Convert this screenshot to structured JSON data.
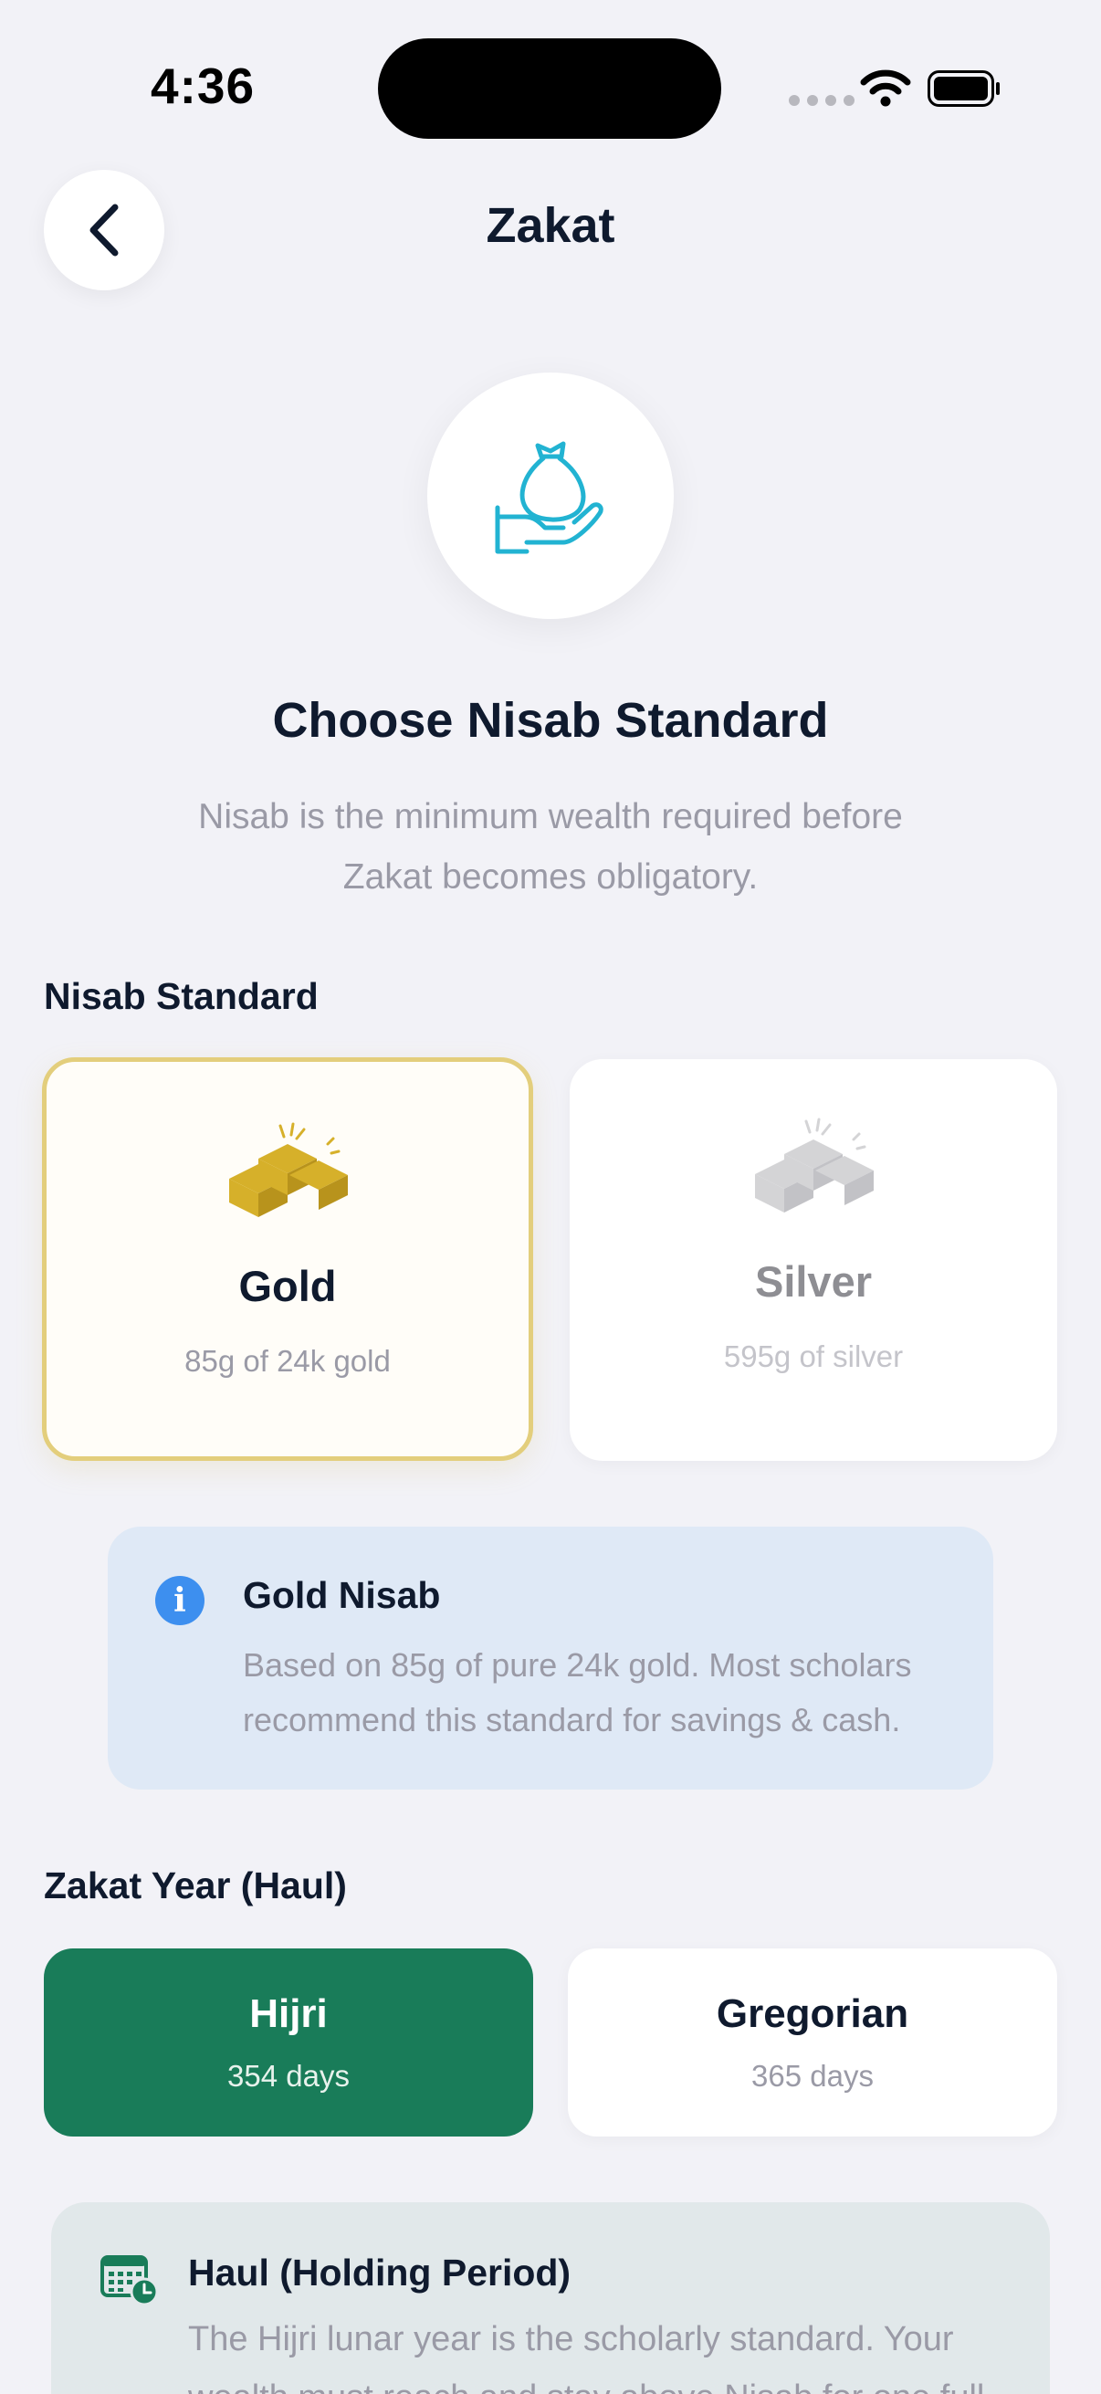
{
  "status_bar": {
    "time": "4:36"
  },
  "header": {
    "title": "Zakat"
  },
  "hero": {
    "title": "Choose Nisab Standard",
    "subtitle": "Nisab is the minimum wealth required before Zakat becomes obligatory."
  },
  "nisab": {
    "section_label": "Nisab Standard",
    "options": [
      {
        "name": "Gold",
        "desc": "85g of 24k gold",
        "selected": true
      },
      {
        "name": "Silver",
        "desc": "595g of silver",
        "selected": false
      }
    ],
    "info": {
      "title": "Gold Nisab",
      "text": "Based on 85g of pure 24k gold. Most scholars recommend this standard for savings & cash."
    }
  },
  "haul": {
    "section_label": "Zakat Year (Haul)",
    "options": [
      {
        "name": "Hijri",
        "days": "354 days",
        "selected": true
      },
      {
        "name": "Gregorian",
        "days": "365 days",
        "selected": false
      }
    ],
    "note": {
      "title": "Haul (Holding Period)",
      "text": "The Hijri lunar year is the scholarly standard. Your wealth must reach and stay above Nisab for one full"
    }
  },
  "colors": {
    "background": "#F2F2F7",
    "gold_accent": "#D6B02A",
    "selected_border": "#E3CE7C",
    "haul_selected": "#197C59",
    "hero_icon": "#22B3D2",
    "info_bg": "#DFE9F6",
    "info_icon": "#3D8FEF"
  },
  "icons": {
    "back": "chevron-left-icon",
    "hero": "money-bag-hand-icon",
    "gold": "gold-bars-icon",
    "silver": "silver-bars-icon",
    "info": "info-icon",
    "note": "calendar-clock-icon"
  }
}
